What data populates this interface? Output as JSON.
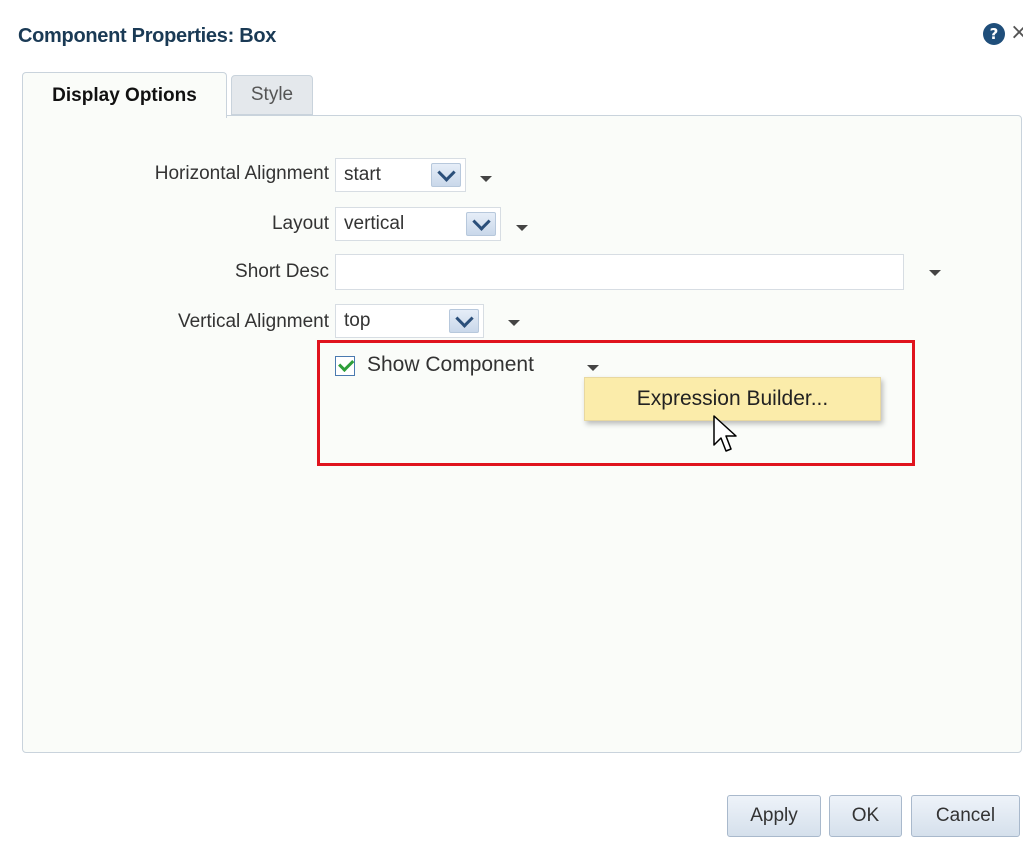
{
  "dialog": {
    "title": "Component Properties: Box",
    "help_icon": "?",
    "close_icon": "×"
  },
  "tabs": [
    {
      "label": "Display Options",
      "active": true
    },
    {
      "label": "Style",
      "active": false
    }
  ],
  "fields": {
    "horizontal_alignment": {
      "label": "Horizontal Alignment",
      "value": "start"
    },
    "layout": {
      "label": "Layout",
      "value": "vertical"
    },
    "short_desc": {
      "label": "Short Desc",
      "value": ""
    },
    "vertical_alignment": {
      "label": "Vertical Alignment",
      "value": "top"
    },
    "show_component": {
      "label": "Show Component",
      "checked": true
    }
  },
  "popup_menu": {
    "items": [
      "Expression Builder..."
    ]
  },
  "buttons": {
    "apply": "Apply",
    "ok": "OK",
    "cancel": "Cancel"
  },
  "colors": {
    "title": "#1a3a55",
    "highlight_border": "#e0141e",
    "menu_background": "#fbecaa",
    "checkmark": "#2e9e3a"
  }
}
